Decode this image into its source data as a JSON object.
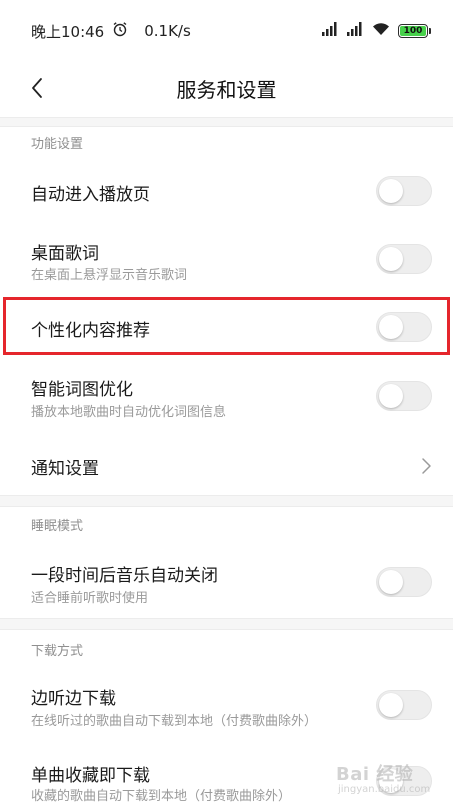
{
  "status_bar": {
    "time": "晚上10:46",
    "speed": "0.1K/s",
    "battery": "100",
    "battery_level": 1.0,
    "icons": [
      "alarm-icon",
      "signal-icon",
      "signal-icon-2",
      "wifi-icon",
      "battery-icon"
    ]
  },
  "header": {
    "title": "服务和设置",
    "back_icon": "chevron-left-icon"
  },
  "sections": {
    "function": {
      "title": "功能设置"
    },
    "sleep": {
      "title": "睡眠模式"
    },
    "download": {
      "title": "下载方式"
    }
  },
  "rows": {
    "auto_player": {
      "title": "自动进入播放页",
      "on": false
    },
    "desktop_lyrics": {
      "title": "桌面歌词",
      "subtitle": "在桌面上悬浮显示音乐歌词",
      "on": false
    },
    "personalized": {
      "title": "个性化内容推荐",
      "on": false
    },
    "smart_lyrics": {
      "title": "智能词图优化",
      "subtitle": "播放本地歌曲时自动优化词图信息",
      "on": false
    },
    "notification": {
      "title": "通知设置",
      "icon": "chevron-right-icon"
    },
    "auto_close": {
      "title": "一段时间后音乐自动关闭",
      "subtitle": "适合睡前听歌时使用",
      "on": false
    },
    "listen_download": {
      "title": "边听边下载",
      "subtitle": "在线听过的歌曲自动下载到本地（付费歌曲除外）",
      "on": false
    },
    "fav_download": {
      "title": "单曲收藏即下载",
      "subtitle": "收藏的歌曲自动下载到本地（付费歌曲除外）",
      "on": false
    }
  },
  "colors": {
    "highlight": "#e5262c",
    "battery_green": "#47d14b",
    "toggle_off": "#eeeeee"
  },
  "watermark": {
    "text": "Bai 经验",
    "sub": "jingyan.baidu.com"
  }
}
